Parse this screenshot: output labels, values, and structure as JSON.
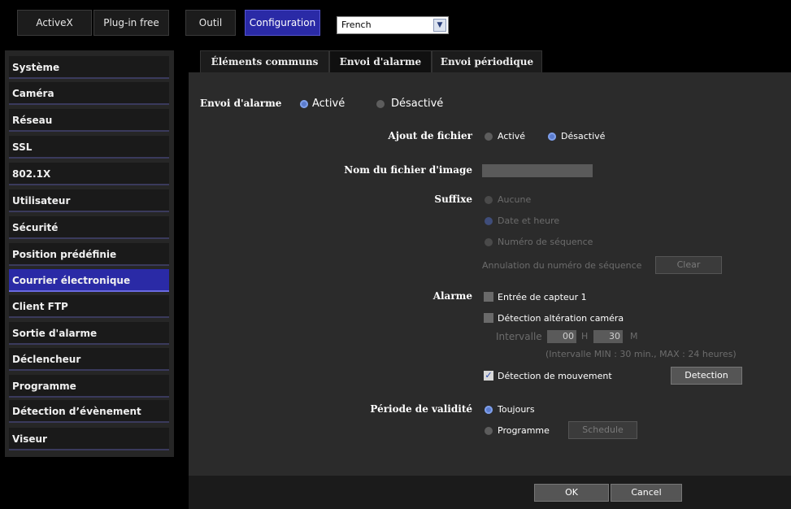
{
  "topbar": {
    "activex": "ActiveX",
    "plugin_free": "Plug-in free",
    "outil": "Outil",
    "configuration": "Configuration",
    "language": "French"
  },
  "sidebar": {
    "items": [
      "Système",
      "Caméra",
      "Réseau",
      "SSL",
      "802.1X",
      "Utilisateur",
      "Sécurité",
      "Position prédéfinie",
      "Courrier électronique",
      "Client FTP",
      "Sortie d'alarme",
      "Déclencheur",
      "Programme",
      "Détection d’évènement",
      "Viseur"
    ],
    "active_index": 8
  },
  "tabs": [
    "Éléments communs",
    "Envoi d'alarme",
    "Envoi périodique"
  ],
  "form": {
    "envoi_alarme": {
      "label": "Envoi d'alarme",
      "on": "Activé",
      "off": "Désactivé"
    },
    "ajout_fichier": {
      "label": "Ajout de fichier",
      "on": "Activé",
      "off": "Désactivé"
    },
    "nom_fichier": {
      "label": "Nom du fichier d'image",
      "value": ""
    },
    "suffixe": {
      "label": "Suffixe",
      "aucune": "Aucune",
      "date": "Date et heure",
      "numero": "Numéro de séquence",
      "annulation": "Annulation du numéro de séquence",
      "clear": "Clear"
    },
    "alarme": {
      "label": "Alarme",
      "capteur": "Entrée de capteur 1",
      "alteration": "Détection altération caméra",
      "intervalle": "Intervalle",
      "hours": "00",
      "h": "H",
      "minutes": "30",
      "m": "M",
      "intervalle_note": "(Intervalle MIN : 30 min., MAX : 24 heures)",
      "mouvement": "Détection de mouvement",
      "detection_btn": "Detection"
    },
    "periode": {
      "label": "Période de validité",
      "toujours": "Toujours",
      "programme": "Programme",
      "schedule": "Schedule"
    }
  },
  "footer": {
    "ok": "OK",
    "cancel": "Cancel"
  },
  "colors": {
    "accent": "#2a2aa6",
    "radio_on": "#5b7ccf"
  }
}
